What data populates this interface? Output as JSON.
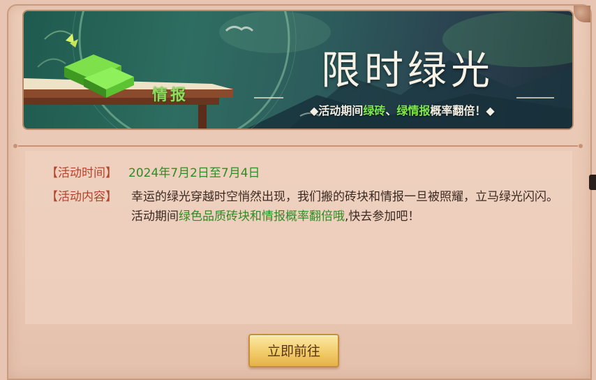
{
  "banner": {
    "title": "限时绿光",
    "item_label": "情报",
    "subtitle_prefix": "◆活动期间",
    "subtitle_green1": "绿砖",
    "subtitle_sep": "、",
    "subtitle_green2": "绿情报",
    "subtitle_suffix": "概率翻倍！◆"
  },
  "info": {
    "time_label": "【活动时间】",
    "time_value": "2024年7月2日至7月4日",
    "content_label": "【活动内容】",
    "content_line1": "幸运的绿光穿越时空悄然出现，我们搬的砖块和情报一旦被照耀，立马绿光闪闪。",
    "content_line2_prefix": "活动期间",
    "content_line2_highlight": "绿色品质砖块和情报概率翻倍哦",
    "content_line2_suffix": ",快去参加吧！"
  },
  "actions": {
    "go_label": "立即前往"
  },
  "colors": {
    "label_red": "#b3452c",
    "highlight_green": "#2e8c22",
    "button_gold": "#f2cc6a"
  }
}
